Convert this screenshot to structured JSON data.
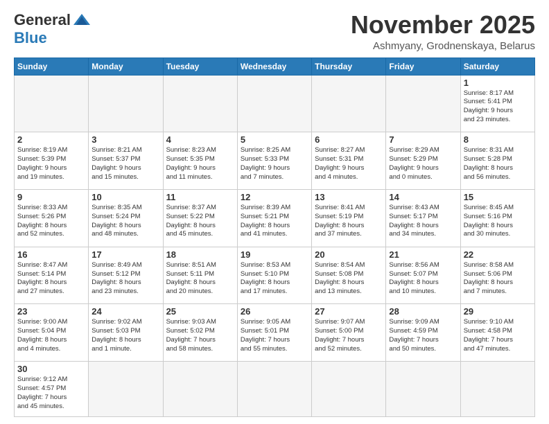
{
  "header": {
    "logo": {
      "general": "General",
      "blue": "Blue"
    },
    "title": "November 2025",
    "location": "Ashmyany, Grodnenskaya, Belarus"
  },
  "weekdays": [
    "Sunday",
    "Monday",
    "Tuesday",
    "Wednesday",
    "Thursday",
    "Friday",
    "Saturday"
  ],
  "weeks": [
    [
      {
        "day": "",
        "info": ""
      },
      {
        "day": "",
        "info": ""
      },
      {
        "day": "",
        "info": ""
      },
      {
        "day": "",
        "info": ""
      },
      {
        "day": "",
        "info": ""
      },
      {
        "day": "",
        "info": ""
      },
      {
        "day": "1",
        "info": "Sunrise: 8:17 AM\nSunset: 5:41 PM\nDaylight: 9 hours\nand 23 minutes."
      }
    ],
    [
      {
        "day": "2",
        "info": "Sunrise: 8:19 AM\nSunset: 5:39 PM\nDaylight: 9 hours\nand 19 minutes."
      },
      {
        "day": "3",
        "info": "Sunrise: 8:21 AM\nSunset: 5:37 PM\nDaylight: 9 hours\nand 15 minutes."
      },
      {
        "day": "4",
        "info": "Sunrise: 8:23 AM\nSunset: 5:35 PM\nDaylight: 9 hours\nand 11 minutes."
      },
      {
        "day": "5",
        "info": "Sunrise: 8:25 AM\nSunset: 5:33 PM\nDaylight: 9 hours\nand 7 minutes."
      },
      {
        "day": "6",
        "info": "Sunrise: 8:27 AM\nSunset: 5:31 PM\nDaylight: 9 hours\nand 4 minutes."
      },
      {
        "day": "7",
        "info": "Sunrise: 8:29 AM\nSunset: 5:29 PM\nDaylight: 9 hours\nand 0 minutes."
      },
      {
        "day": "8",
        "info": "Sunrise: 8:31 AM\nSunset: 5:28 PM\nDaylight: 8 hours\nand 56 minutes."
      }
    ],
    [
      {
        "day": "9",
        "info": "Sunrise: 8:33 AM\nSunset: 5:26 PM\nDaylight: 8 hours\nand 52 minutes."
      },
      {
        "day": "10",
        "info": "Sunrise: 8:35 AM\nSunset: 5:24 PM\nDaylight: 8 hours\nand 48 minutes."
      },
      {
        "day": "11",
        "info": "Sunrise: 8:37 AM\nSunset: 5:22 PM\nDaylight: 8 hours\nand 45 minutes."
      },
      {
        "day": "12",
        "info": "Sunrise: 8:39 AM\nSunset: 5:21 PM\nDaylight: 8 hours\nand 41 minutes."
      },
      {
        "day": "13",
        "info": "Sunrise: 8:41 AM\nSunset: 5:19 PM\nDaylight: 8 hours\nand 37 minutes."
      },
      {
        "day": "14",
        "info": "Sunrise: 8:43 AM\nSunset: 5:17 PM\nDaylight: 8 hours\nand 34 minutes."
      },
      {
        "day": "15",
        "info": "Sunrise: 8:45 AM\nSunset: 5:16 PM\nDaylight: 8 hours\nand 30 minutes."
      }
    ],
    [
      {
        "day": "16",
        "info": "Sunrise: 8:47 AM\nSunset: 5:14 PM\nDaylight: 8 hours\nand 27 minutes."
      },
      {
        "day": "17",
        "info": "Sunrise: 8:49 AM\nSunset: 5:12 PM\nDaylight: 8 hours\nand 23 minutes."
      },
      {
        "day": "18",
        "info": "Sunrise: 8:51 AM\nSunset: 5:11 PM\nDaylight: 8 hours\nand 20 minutes."
      },
      {
        "day": "19",
        "info": "Sunrise: 8:53 AM\nSunset: 5:10 PM\nDaylight: 8 hours\nand 17 minutes."
      },
      {
        "day": "20",
        "info": "Sunrise: 8:54 AM\nSunset: 5:08 PM\nDaylight: 8 hours\nand 13 minutes."
      },
      {
        "day": "21",
        "info": "Sunrise: 8:56 AM\nSunset: 5:07 PM\nDaylight: 8 hours\nand 10 minutes."
      },
      {
        "day": "22",
        "info": "Sunrise: 8:58 AM\nSunset: 5:06 PM\nDaylight: 8 hours\nand 7 minutes."
      }
    ],
    [
      {
        "day": "23",
        "info": "Sunrise: 9:00 AM\nSunset: 5:04 PM\nDaylight: 8 hours\nand 4 minutes."
      },
      {
        "day": "24",
        "info": "Sunrise: 9:02 AM\nSunset: 5:03 PM\nDaylight: 8 hours\nand 1 minute."
      },
      {
        "day": "25",
        "info": "Sunrise: 9:03 AM\nSunset: 5:02 PM\nDaylight: 7 hours\nand 58 minutes."
      },
      {
        "day": "26",
        "info": "Sunrise: 9:05 AM\nSunset: 5:01 PM\nDaylight: 7 hours\nand 55 minutes."
      },
      {
        "day": "27",
        "info": "Sunrise: 9:07 AM\nSunset: 5:00 PM\nDaylight: 7 hours\nand 52 minutes."
      },
      {
        "day": "28",
        "info": "Sunrise: 9:09 AM\nSunset: 4:59 PM\nDaylight: 7 hours\nand 50 minutes."
      },
      {
        "day": "29",
        "info": "Sunrise: 9:10 AM\nSunset: 4:58 PM\nDaylight: 7 hours\nand 47 minutes."
      }
    ],
    [
      {
        "day": "30",
        "info": "Sunrise: 9:12 AM\nSunset: 4:57 PM\nDaylight: 7 hours\nand 45 minutes."
      },
      {
        "day": "",
        "info": ""
      },
      {
        "day": "",
        "info": ""
      },
      {
        "day": "",
        "info": ""
      },
      {
        "day": "",
        "info": ""
      },
      {
        "day": "",
        "info": ""
      },
      {
        "day": "",
        "info": ""
      }
    ]
  ]
}
